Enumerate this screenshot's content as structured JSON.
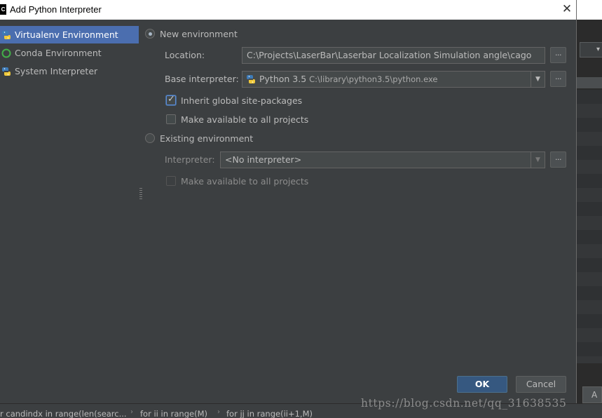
{
  "window": {
    "title": "Add Python Interpreter",
    "app_icon_text": "C",
    "close_icon": "close-icon"
  },
  "sidebar": {
    "items": [
      {
        "label": "Virtualenv Environment",
        "icon": "virtualenv-icon",
        "selected": true
      },
      {
        "label": "Conda Environment",
        "icon": "conda-icon",
        "selected": false
      },
      {
        "label": "System Interpreter",
        "icon": "python-icon",
        "selected": false
      }
    ]
  },
  "new_env": {
    "radio_label": "New environment",
    "selected": true,
    "location_label": "Location:",
    "location_value": "C:\\Projects\\LaserBar\\Laserbar Localization Simulation angle\\cago",
    "base_label": "Base interpreter:",
    "base_name": "Python 3.5",
    "base_path": "C:\\library\\python3.5\\python.exe",
    "inherit_label": "Inherit global site-packages",
    "inherit_checked": true,
    "make_available_label": "Make available to all projects",
    "make_available_checked": false,
    "browse_label": "..."
  },
  "existing_env": {
    "radio_label": "Existing environment",
    "selected": false,
    "interpreter_label": "Interpreter:",
    "interpreter_value": "<No interpreter>",
    "make_available_label": "Make available to all projects",
    "make_available_checked": false,
    "browse_label": "..."
  },
  "buttons": {
    "ok": "OK",
    "cancel": "Cancel"
  },
  "background": {
    "breadcrumbs": [
      "r candindx in range(len(searc...",
      "for ii in range(M)",
      "for jj in range(ii+1,M)"
    ],
    "separator": "›",
    "partial_button_label": "A",
    "watermark": "https://blog.csdn.net/qq_31638535"
  },
  "colors": {
    "dialog_bg": "#3c3f41",
    "selection": "#4b6eaf",
    "ok_button": "#365880",
    "text": "#bbbbbb"
  }
}
